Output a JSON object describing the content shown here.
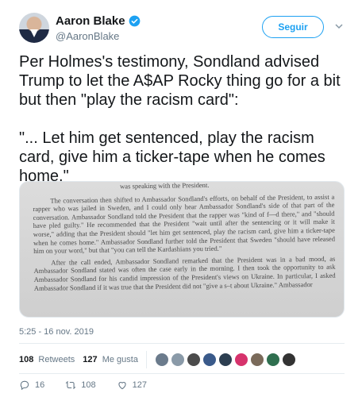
{
  "author": {
    "display_name": "Aaron Blake",
    "handle": "@AaronBlake",
    "verified": true
  },
  "follow_button_label": "Seguir",
  "tweet": {
    "paragraph1": "Per Holmes's testimony, Sondland advised Trump to let the A$AP Rocky thing go for a bit but then \"play the racism card\":",
    "paragraph2": "\"... Let him get sentenced, play the racism card, give him a ticker-tape when he comes home.\""
  },
  "attached_document": {
    "cut_line": "was speaking with the President.",
    "para1": "The conversation then shifted to Ambassador Sondland's efforts, on behalf of the President, to assist a rapper who was jailed in Sweden, and I could only hear Ambassador Sondland's side of that part of the conversation. Ambassador Sondland told the President that the rapper was \"kind of f—d there,\" and \"should have pled guilty.\" He recommended that the President \"wait until after the sentencing or it will make it worse,\" adding that the President should \"let him get sentenced, play the racism card, give him a ticker-tape when he comes home.\" Ambassador Sondland further told the President that Sweden \"should have released him on your word,\" but that \"you can tell the Kardashians you tried.\"",
    "para2": "After the call ended, Ambassador Sondland remarked that the President was in a bad mood, as Ambassador Sondland stated was often the case early in the morning. I then took the opportunity to ask Ambassador Sondland for his candid impression of the President's views on Ukraine. In particular, I asked Ambassador Sondland if it was true that the President did not \"give a s–t about Ukraine.\" Ambassador"
  },
  "timestamp": "5:25 - 16 nov. 2019",
  "stats": {
    "retweets_count": "108",
    "retweets_label": "Retweets",
    "likes_count": "127",
    "likes_label": "Me gusta"
  },
  "liker_avatar_colors": [
    "#6b7b8c",
    "#8a9aa8",
    "#4b4b4b",
    "#3a5a8a",
    "#2c3e50",
    "#d6336c",
    "#7a6a5a",
    "#2f6f4f",
    "#333333"
  ],
  "actions": {
    "replies": "16",
    "retweets": "108",
    "likes": "127"
  },
  "colors": {
    "accent": "#1da1f2",
    "text": "#14171a",
    "secondary": "#657786"
  },
  "icons": [
    "verified-badge-icon",
    "chevron-down-icon",
    "reply-icon",
    "retweet-icon",
    "heart-icon"
  ]
}
